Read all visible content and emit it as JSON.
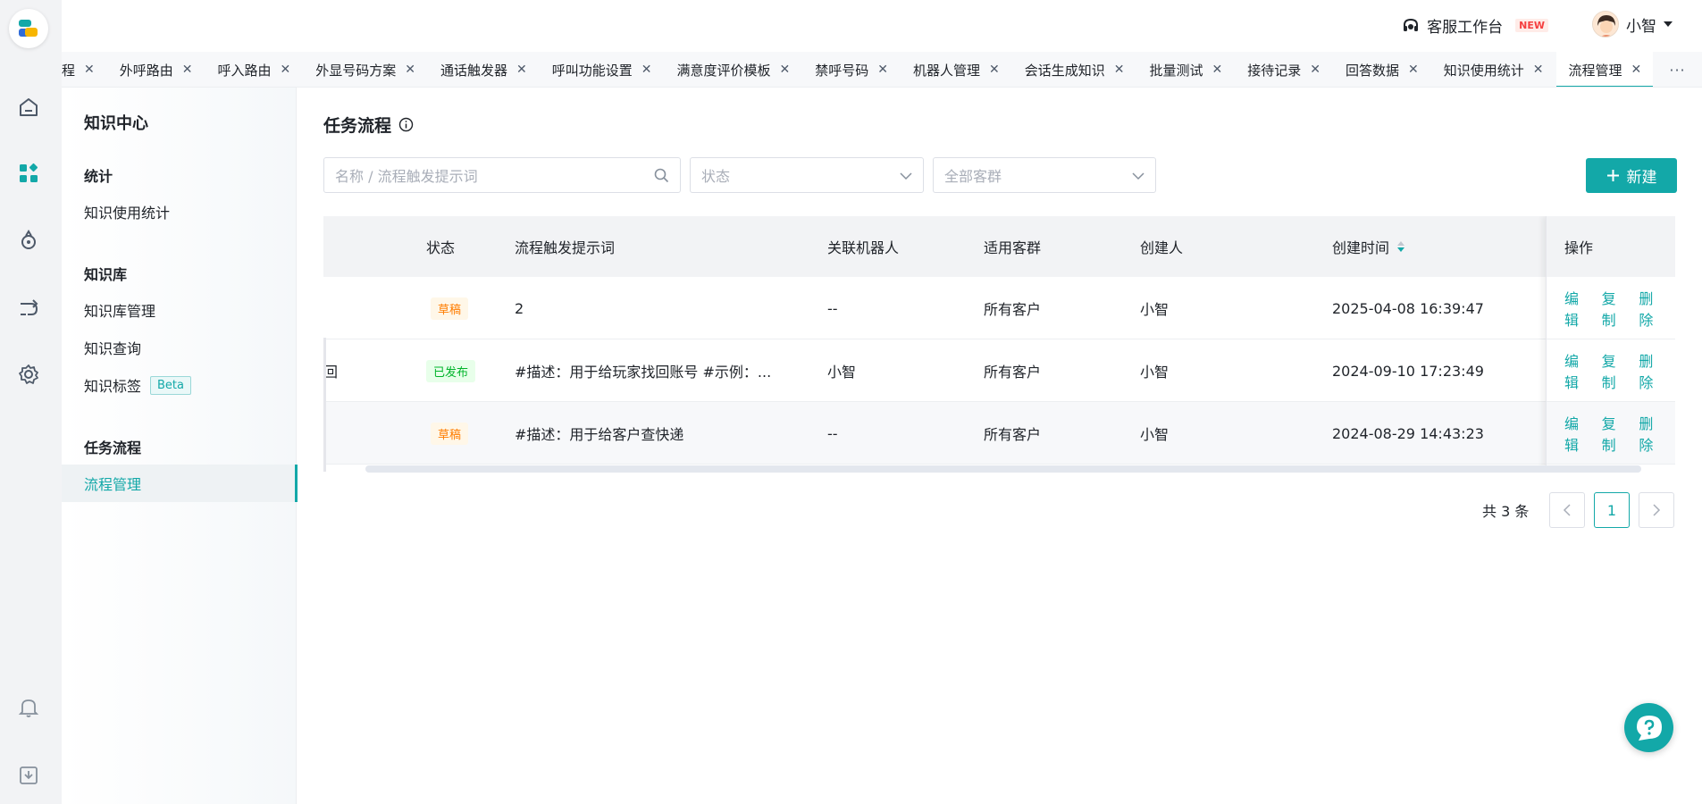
{
  "topbar": {
    "workbench_label": "客服工作台",
    "workbench_badge": "NEW",
    "user_name": "小智"
  },
  "tabs": [
    {
      "label": "程"
    },
    {
      "label": "外呼路由"
    },
    {
      "label": "呼入路由"
    },
    {
      "label": "外显号码方案"
    },
    {
      "label": "通话触发器"
    },
    {
      "label": "呼叫功能设置"
    },
    {
      "label": "满意度评价模板"
    },
    {
      "label": "禁呼号码"
    },
    {
      "label": "机器人管理"
    },
    {
      "label": "会话生成知识"
    },
    {
      "label": "批量测试"
    },
    {
      "label": "接待记录"
    },
    {
      "label": "回答数据"
    },
    {
      "label": "知识使用统计"
    },
    {
      "label": "流程管理",
      "active": true
    }
  ],
  "tabs_more": "···",
  "sidemenu": {
    "title": "知识中心",
    "groups": [
      {
        "label": "统计",
        "items": [
          {
            "label": "知识使用统计"
          }
        ]
      },
      {
        "label": "知识库",
        "items": [
          {
            "label": "知识库管理"
          },
          {
            "label": "知识查询"
          },
          {
            "label": "知识标签",
            "badge": "Beta"
          }
        ]
      },
      {
        "label": "任务流程",
        "items": [
          {
            "label": "流程管理",
            "active": true
          }
        ]
      }
    ]
  },
  "page": {
    "title": "任务流程",
    "filters": {
      "search_placeholder": "名称 / 流程触发提示词",
      "status_placeholder": "状态",
      "group_placeholder": "全部客群"
    },
    "new_button": "新建"
  },
  "table": {
    "columns": [
      "状态",
      "流程触发提示词",
      "关联机器人",
      "适用客群",
      "创建人",
      "创建时间",
      "操作"
    ],
    "rows": [
      {
        "name_tail": "",
        "status": "草稿",
        "status_type": "draft",
        "trigger": "2",
        "robot": "--",
        "group": "所有客户",
        "creator": "小智",
        "created": "2025-04-08 16:39:47"
      },
      {
        "name_tail": "回",
        "status": "已发布",
        "status_type": "published",
        "trigger": "#描述：用于给玩家找回账号 #示例：...",
        "robot": "小智",
        "group": "所有客户",
        "creator": "小智",
        "created": "2024-09-10 17:23:49"
      },
      {
        "name_tail": "",
        "status": "草稿",
        "status_type": "draft",
        "trigger": "#描述：用于给客户查快递",
        "robot": "--",
        "group": "所有客户",
        "creator": "小智",
        "created": "2024-08-29 14:43:23"
      }
    ],
    "actions": [
      "编辑",
      "复制",
      "删除"
    ]
  },
  "pagination": {
    "total_text": "共 3 条",
    "current_page": "1"
  },
  "colors": {
    "accent": "#13a8a8",
    "draft": "#ff7d00",
    "published": "#00b42a"
  }
}
